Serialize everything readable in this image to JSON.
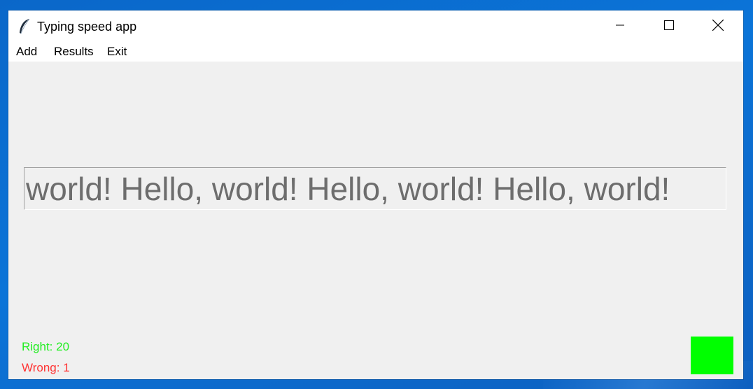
{
  "window": {
    "title": "Typing speed app",
    "controls": {
      "minimize_icon": "minimize-icon",
      "maximize_icon": "maximize-icon",
      "close_icon": "close-icon"
    }
  },
  "menu": {
    "items": [
      {
        "label": "Add"
      },
      {
        "label": "Results"
      },
      {
        "label": "Exit"
      }
    ]
  },
  "typing": {
    "display_text": "world! Hello, world! Hello, world! Hello, world!"
  },
  "stats": {
    "right": "Right: 20",
    "wrong": "Wrong: 1"
  },
  "status": {
    "indicator_color": "#00ff00"
  },
  "colors": {
    "right_text": "#22ee22",
    "wrong_text": "#ff3333",
    "desktop": "#0b74d8"
  }
}
